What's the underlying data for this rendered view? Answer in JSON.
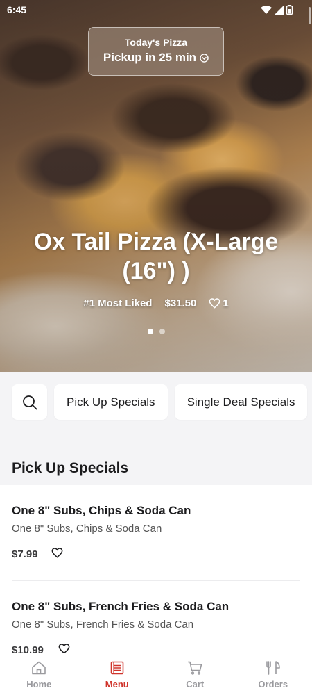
{
  "status_bar": {
    "time": "6:45"
  },
  "hero": {
    "pickup_title": "Today's Pizza",
    "pickup_subtitle": "Pickup in 25 min",
    "product_title": "Ox Tail Pizza (X-Large (16\") )",
    "rank": "#1 Most Liked",
    "price": "$31.50",
    "likes": "1",
    "carousel_total": 2,
    "carousel_active": 1
  },
  "categories": {
    "search_icon": "search-icon",
    "items": [
      "Pick Up Specials",
      "Single Deal Specials"
    ]
  },
  "section": {
    "title": "Pick Up Specials"
  },
  "items": [
    {
      "name": "One 8\" Subs, Chips & Soda Can",
      "description": "One 8\" Subs, Chips & Soda Can",
      "price": "$7.99"
    },
    {
      "name": "One 8\" Subs, French Fries & Soda Can",
      "description": "One 8\" Subs, French Fries & Soda Can",
      "price": "$10.99"
    }
  ],
  "bottom_nav": [
    {
      "label": "Home",
      "icon": "home-icon",
      "active": false
    },
    {
      "label": "Menu",
      "icon": "menu-icon",
      "active": true
    },
    {
      "label": "Cart",
      "icon": "cart-icon",
      "active": false
    },
    {
      "label": "Orders",
      "icon": "orders-icon",
      "active": false
    }
  ],
  "colors": {
    "accent": "#d0342c",
    "inactive": "#9a9a9e"
  }
}
